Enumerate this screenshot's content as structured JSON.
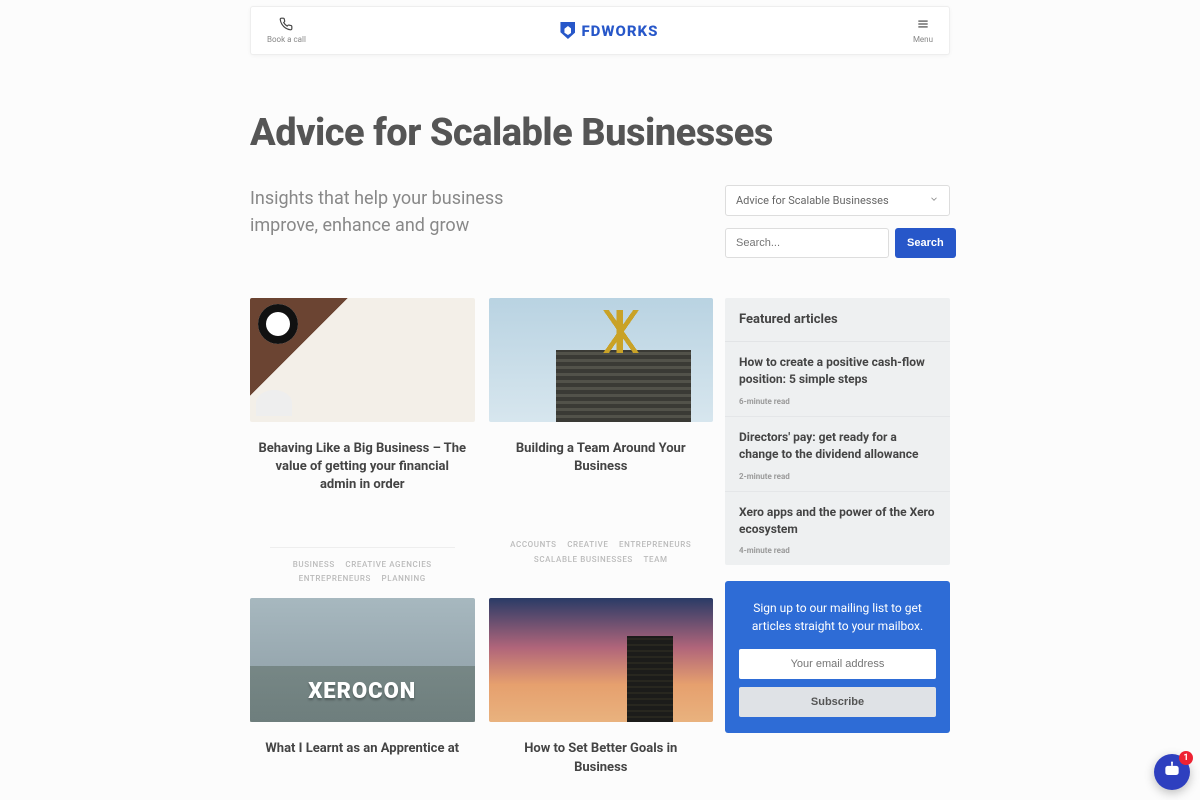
{
  "header": {
    "book_call": "Book a call",
    "menu": "Menu",
    "brand": "FDWORKS"
  },
  "page": {
    "title": "Advice for Scalable Businesses",
    "subtitle_line1": "Insights that help your business",
    "subtitle_line2": "improve, enhance and grow"
  },
  "controls": {
    "category_selected": "Advice for Scalable Businesses",
    "search_placeholder": "Search...",
    "search_button": "Search"
  },
  "articles": [
    {
      "title": "Behaving Like a Big Business – The value of getting your financial admin in order",
      "tags": [
        "BUSINESS",
        "CREATIVE AGENCIES",
        "ENTREPRENEURS",
        "PLANNING"
      ]
    },
    {
      "title": "Building a Team Around Your Business",
      "tags": [
        "ACCOUNTS",
        "CREATIVE",
        "ENTREPRENEURS",
        "SCALABLE BUSINESSES",
        "TEAM"
      ]
    },
    {
      "title": "What I Learnt as an Apprentice at",
      "xerocon_text": "XEROCON",
      "tags": []
    },
    {
      "title": "How to Set Better Goals in Business",
      "tags": []
    }
  ],
  "featured": {
    "heading": "Featured articles",
    "items": [
      {
        "title": "How to create a positive cash-flow position: 5 simple steps",
        "meta": "6-minute read"
      },
      {
        "title": "Directors' pay: get ready for a change to the dividend allowance",
        "meta": "2-minute read"
      },
      {
        "title": "Xero apps and the power of the Xero ecosystem",
        "meta": "4-minute read"
      }
    ]
  },
  "signup": {
    "text": "Sign up to our mailing list to get articles straight to your mailbox.",
    "email_placeholder": "Your email address",
    "button": "Subscribe"
  },
  "chat": {
    "badge": "1"
  }
}
